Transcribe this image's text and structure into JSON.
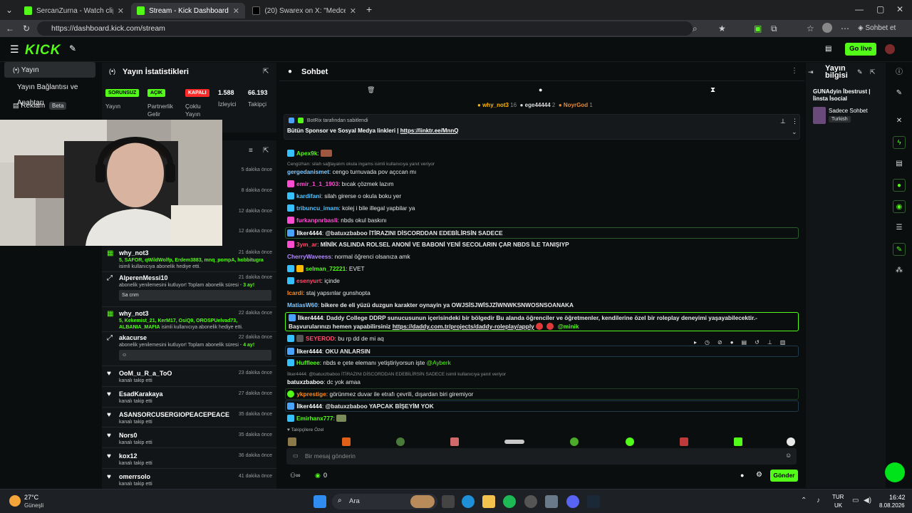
{
  "browser": {
    "tabs": [
      {
        "label": "SercanZurna - Watch clips on Kick"
      },
      {
        "label": "Stream - Kick Dashboard"
      },
      {
        "label": "(20) Swarex on X: \"Medcezir edit |"
      }
    ],
    "url": "https://dashboard.kick.com/stream",
    "profile_label": "Sohbet et"
  },
  "header": {
    "logo": "KICK",
    "go_live": "Go live"
  },
  "nav": {
    "items": [
      {
        "label": "Yayın"
      },
      {
        "label": "Yayın Bağlantısı ve Anahtarı"
      },
      {
        "label": "Reklam",
        "badge": "Beta"
      }
    ]
  },
  "stats": {
    "title": "Yayın İstatistikleri",
    "pills": [
      "SORUNSUZ",
      "AÇIK",
      "KAPALI"
    ],
    "labels": [
      "Yayın",
      "Partnerlik Gelir",
      "Çoklu Yayın",
      "İzleyici",
      "Takipçi"
    ],
    "viewers": "1.588",
    "followers": "66.193"
  },
  "activity": {
    "times": [
      "5 dakika önce",
      "8 dakika önce",
      "12 dakika önce",
      "12 dakika önce"
    ],
    "events": [
      {
        "name": "why_not3",
        "time": "21 dakika önce",
        "text1": "5, SAFOR, qWildWolfp, Erdem3883, mnq_pompA, hobbitugra",
        "text2": "isimli kullanıcıya abonelik hediye etti."
      },
      {
        "name": "AlperenMessi10",
        "time": "21 dakika önce",
        "text": "abonelik yenilemesini kutluyor! Toplam abonelik süresi -",
        "dur": "3 ay!",
        "box": "Sa cnm"
      },
      {
        "name": "why_not3",
        "time": "22 dakika önce",
        "text1": "5, Kekemist_21, KerM17, OsiQ9, OROSPUelvad73, ALBANIA_MAFIA",
        "text2": "isimli kullanıcıya abonelik hediye etti."
      },
      {
        "name": "akacurse",
        "time": "22 dakika önce",
        "text": "abonelik yenilemesini kutluyor! Toplam abonelik süresi -",
        "dur": "4 ay!"
      },
      {
        "name": "OoM_u_R_a_ToO",
        "time": "23 dakika önce",
        "text": "kanalı takip etti"
      },
      {
        "name": "EsadKarakaya",
        "time": "27 dakika önce",
        "text": "kanalı takip etti"
      },
      {
        "name": "ASANSORCUSERGIOPEACEPEACE",
        "time": "35 dakika önce",
        "text": "kanalı takip etti"
      },
      {
        "name": "Nors0",
        "time": "35 dakika önce",
        "text": "kanalı takip etti"
      },
      {
        "name": "kox12",
        "time": "36 dakika önce",
        "text": "kanalı takip etti"
      },
      {
        "name": "omerrsolo",
        "time": "41 dakika önce",
        "text": "kanalı takip etti"
      }
    ]
  },
  "chat": {
    "title": "Sohbet",
    "top_chatters": [
      {
        "name": "why_not3",
        "count": "16"
      },
      {
        "name": "ege44444",
        "count": "2"
      },
      {
        "name": "NoyrGod",
        "count": "1"
      }
    ],
    "pinned_by": "BotRix tarafından sabitlendi",
    "pinned_text": "Bütün Sponsor ve Sosyal Medya linkleri |",
    "pinned_link": "https://linktr.ee/MnnQ",
    "messages": [
      {
        "user": "Apex9k",
        "text": "",
        "color": "#53fc18"
      },
      {
        "reply": "Cengizhan: silah sağlayalım okula ingams isimli kullanıcıya yanıt veriyor"
      },
      {
        "user": "gergedanismet",
        "text": "cengo turnuvada pov açccan mı",
        "color": "#7ec8ff"
      },
      {
        "user": "emir_1_1_1903",
        "text": "bıcak çözmek lazım",
        "color": "#ff4dd2"
      },
      {
        "user": "kardifani",
        "text": "silah girerse o okula boku yer",
        "color": "#4dc3ff"
      },
      {
        "user": "tribuncu_imam",
        "text": "kolej i bile illegal yapbilar ya",
        "color": "#4dc3ff"
      },
      {
        "user": "furkanpnrbasli",
        "text": "nbds okul baskını",
        "color": "#ff4dd2"
      },
      {
        "user": "İlker4444",
        "text": "@batuxzbaboo İTİRAZINI DİSCORDDAN EDEBİLİRSİN SADECE",
        "color": "#ffffff"
      },
      {
        "user": "3ym_ar",
        "text": "MİNİK ASLINDA ROLSEL ANONİ VE BABONİ YENİ SECOLARIN ÇAR NBDS İLE TANIŞIYP",
        "color": "#ff4d6d"
      },
      {
        "user": "CherryWaveess",
        "text": "normal öğrenci olsanıza amk",
        "color": "#b38bff"
      },
      {
        "user": "selman_72221",
        "text": "EVET",
        "color": "#53fc18"
      },
      {
        "user": "esenyurt",
        "text": "içinde",
        "color": "#ff4d6d"
      },
      {
        "user": "Icardi",
        "text": "staj yapsınlar gunshopta",
        "color": "#ff8c1a"
      },
      {
        "user": "MatiasW60",
        "text": "bikere de eli yüzü duzgun karakter oynayin ya OWJSİSJWİSJZİWNWKSNWOSNSOANAKA",
        "color": "#7ec8ff"
      },
      {
        "user": "İlker4444",
        "text": "Daddy College DDRP sunucusunun içerisindeki bir bölgedir Bu alanda öğrenciler ve öğretmenler, kendilerine özel bir roleplay deneyimi yaşayabilecektir.- Başvurularınızı hemen",
        "text2": "yapabilirsiniz",
        "link": "https://daddy.com.tr/projects/daddy-roleplay/apply",
        "mention": "@minik",
        "color": "#ffffff"
      },
      {
        "user": "SEYEROD",
        "text": "bu rp dd de mi aq",
        "color": "#ff4d6d"
      },
      {
        "user": "İlker4444",
        "text": "OKU ANLARSIN",
        "color": "#ffffff"
      },
      {
        "user": "Huffleee",
        "text": "nbds e çete elemanı yetiştiriyorsun işte",
        "mention": "@Ayberk",
        "color": "#53fc18"
      },
      {
        "reply": "İlker4444: @batuxzbaboo İTİRAZINI DİSCORDDAN EDEBİLİRSİN SADECE isimli kullanıcıya yanıt veriyor"
      },
      {
        "user": "batuxzbaboo",
        "text": "dc yok amaa",
        "color": "#ffffff"
      },
      {
        "user": "ykprestige",
        "text": "görünmez duvar ile etrafı çevrili, dışardan biri giremiyor",
        "color": "#ff8c1a"
      },
      {
        "user": "İlker4444",
        "text": "@batuxzbaboo YAPCAK BİŞEYİM YOK",
        "color": "#ffffff"
      },
      {
        "user": "Emirhanx777",
        "text": "",
        "color": "#53fc18"
      }
    ],
    "emote_row_label": "Takipçilere Özel",
    "input_placeholder": "Bir mesaj gönderin",
    "points": "0",
    "send": "Gönder"
  },
  "right_panel": {
    "title": "Yayın bilgisi",
    "stream_title": "GUNAdyin İbestrust | İinsta İsocial",
    "chat_mode": "Sadece Sohbet",
    "language": "Turkish"
  },
  "taskbar": {
    "temp": "27°C",
    "weather": "Güneşli",
    "search": "Ara",
    "lang1": "TUR",
    "lang2": "UK",
    "time": "16:42",
    "date": "8.08.2026"
  },
  "colors": {
    "accent": "#53fc18",
    "bg": "#0b0e0f",
    "panel": "#121517"
  }
}
